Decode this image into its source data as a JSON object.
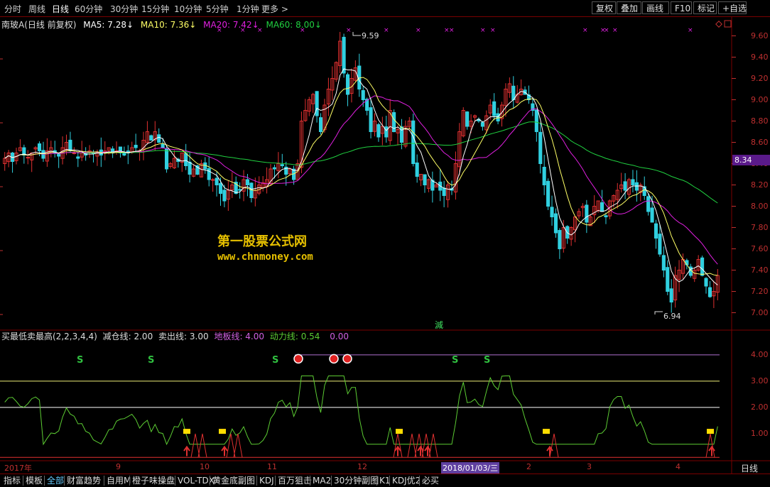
{
  "colors": {
    "up": "#e03030",
    "down": "#30d0e0",
    "ma5": "#ffffff",
    "ma10": "#ffff66",
    "ma20": "#e020e0",
    "ma60": "#20d040",
    "axis": "#c03030",
    "grid": "#7a0000",
    "osc": "#5ccc33",
    "signal": "#ffdd00",
    "level3": "#eeee77",
    "level2": "#ffffff",
    "level4": "#b070d0"
  },
  "toolbar": {
    "timeframes": [
      "分时",
      "周线",
      "日线",
      "60分钟",
      "30分钟",
      "15分钟",
      "10分钟",
      "5分钟",
      "1分钟",
      "更多 >"
    ],
    "active_timeframe": "日线",
    "right_buttons": [
      "复权",
      "叠加",
      "画线",
      "F10",
      "标记",
      "+自选"
    ]
  },
  "price_legend": {
    "title": "南玻A(日线 前复权)",
    "ma5_label": "MA5: 7.28↓",
    "ma10_label": "MA10: 7.36↓",
    "ma20_label": "MA20: 7.42↓",
    "ma60_label": "MA60: 8.00↓"
  },
  "price_panel": {
    "price_ticks": [
      "9.60",
      "9.40",
      "9.20",
      "9.00",
      "8.80",
      "8.60",
      "8.40",
      "8.20",
      "8.00",
      "7.80",
      "7.60",
      "7.40",
      "7.20",
      "7.00"
    ],
    "current_price_tag": "8.34",
    "high_label": "9.59",
    "low_label": "6.94"
  },
  "watermark": {
    "line1": "第一股票公式网",
    "line2": "www.chnmoney.com"
  },
  "reduce_label": "減",
  "indicator_legend": {
    "title": "买最低卖最高(2,2,3,4,4)",
    "reduce_line": "减仓线: 2.00",
    "sell_line": "卖出线: 3.00",
    "floor_line": "地板线: 4.00",
    "power_line": "动力线: 0.54",
    "extra": "0.00"
  },
  "indicator_panel": {
    "ticks": [
      "4.00",
      "3.00",
      "2.00",
      "1.00"
    ],
    "s_label": "S"
  },
  "x_axis": {
    "labels": [
      "2017年",
      "9",
      "10",
      "11",
      "12",
      "2018/01/03/三",
      "2",
      "3",
      "4"
    ],
    "period": "日线"
  },
  "bottom_tabs": [
    "指标",
    "模板",
    "全部",
    "财富趋势",
    "自用M",
    "橙子味操盘",
    "VOL-TDX",
    "黄金底副图",
    "KDJ",
    "百万狙击",
    "MA2",
    "30分钟副图",
    "K1",
    "KDJ优2",
    "必买"
  ],
  "active_tab": "全部",
  "chart_data": {
    "type": "candlestick",
    "ylim": [
      6.85,
      9.65
    ],
    "series": [
      {
        "name": "MA5"
      },
      {
        "name": "MA10"
      },
      {
        "name": "MA20"
      },
      {
        "name": "MA60"
      }
    ],
    "close_path": [
      8.45,
      8.5,
      8.42,
      8.5,
      8.55,
      8.48,
      8.46,
      8.5,
      8.55,
      8.52,
      8.45,
      8.52,
      8.55,
      8.5,
      8.47,
      8.55,
      8.6,
      8.52,
      8.5,
      8.45,
      8.5,
      8.48,
      8.52,
      8.5,
      8.5,
      8.48,
      8.52,
      8.55,
      8.5,
      8.52,
      8.5,
      8.48,
      8.5,
      8.55,
      8.55,
      8.52,
      8.62,
      8.7,
      8.62,
      8.7,
      8.6,
      8.55,
      8.35,
      8.4,
      8.45,
      8.42,
      8.5,
      8.38,
      8.3,
      8.35,
      8.3,
      8.4,
      8.35,
      8.25,
      8.25,
      8.2,
      8.12,
      8.05,
      8.15,
      8.2,
      8.12,
      8.15,
      8.25,
      8.2,
      8.08,
      8.15,
      8.2,
      8.22,
      8.25,
      8.35,
      8.35,
      8.4,
      8.38,
      8.3,
      8.35,
      8.25,
      8.4,
      8.8,
      8.9,
      9.0,
      9.05,
      8.85,
      8.7,
      8.95,
      9.1,
      9.2,
      9.35,
      9.55,
      9.25,
      9.05,
      9.2,
      9.3,
      9.1,
      9.0,
      8.9,
      8.7,
      8.8,
      8.65,
      8.75,
      8.65,
      8.9,
      8.7,
      8.72,
      8.6,
      8.75,
      8.8,
      8.4,
      8.28,
      8.3,
      8.2,
      8.25,
      8.15,
      8.2,
      8.15,
      8.1,
      8.2,
      8.15,
      8.4,
      8.7,
      8.9,
      8.75,
      8.8,
      8.85,
      8.8,
      8.75,
      8.85,
      8.95,
      8.85,
      8.8,
      8.95,
      9.1,
      9.15,
      9.0,
      9.05,
      9.1,
      9.05,
      9.0,
      8.9,
      8.7,
      8.4,
      8.2,
      8.0,
      7.9,
      7.75,
      7.6,
      7.8,
      7.7,
      7.8,
      7.9,
      7.95,
      8.0,
      7.85,
      7.9,
      8.0,
      8.05,
      7.95,
      7.9,
      8.05,
      8.1,
      8.15,
      8.2,
      8.15,
      8.25,
      8.2,
      8.15,
      8.2,
      8.1,
      7.95,
      7.85,
      7.7,
      7.55,
      7.4,
      7.2,
      7.1,
      7.35,
      7.4,
      7.5,
      7.45,
      7.35,
      7.4,
      7.5,
      7.35,
      7.25,
      7.15,
      7.2,
      7.35
    ],
    "indicator_ylim": [
      0,
      4.4
    ],
    "indicator_levels": [
      2.0,
      3.0,
      4.0
    ]
  }
}
